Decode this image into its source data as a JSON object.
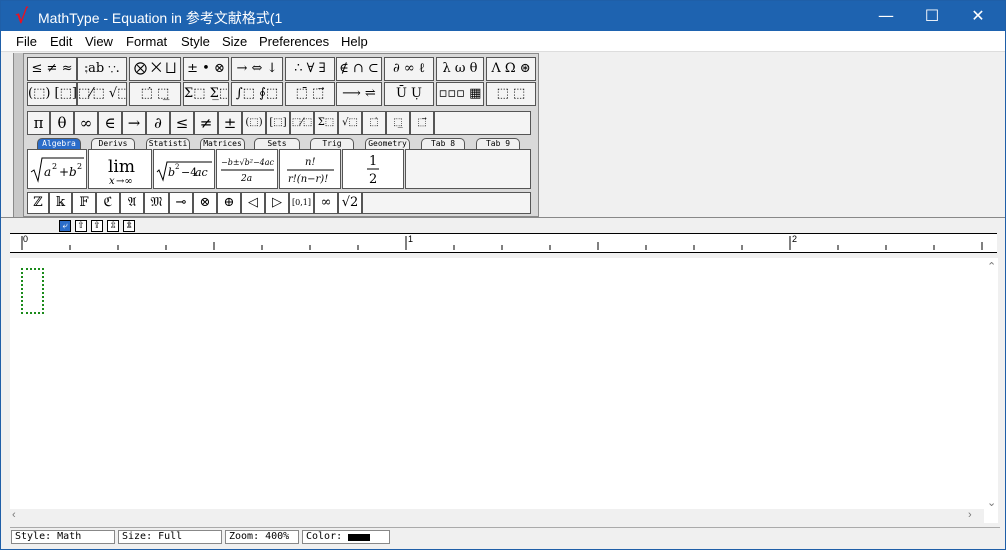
{
  "window": {
    "title": "MathType - Equation in 参考文献格式(1",
    "icon": "mathtype-logo-icon",
    "logo_text": "√",
    "controls": {
      "minimize": "—",
      "maximize": "☐",
      "close": "✕"
    }
  },
  "menubar": {
    "items": [
      "File",
      "Edit",
      "View",
      "Format",
      "Style",
      "Size",
      "Preferences",
      "Help"
    ]
  },
  "palette": {
    "row1": [
      "≤ ≠ ≈",
      "⨟ab ∵.",
      "⨂ ⨉ ⨆",
      "± • ⊗",
      "→ ⇔ ↓",
      "∴ ∀ ∃",
      "∉ ∩ ⊂",
      "∂ ∞ ℓ",
      "λ ω θ",
      "Λ Ω ⊛"
    ],
    "row2": [
      "(⬚) [⬚]",
      "⬚⁄⬚ √⬚",
      "⬚̇ ⬚̲",
      "Σ⬚ Σ̲⬚",
      "∫⬚ ∮⬚",
      "⬚̄ ⬚⃗",
      "⟶ ⇌",
      "Ū Ụ",
      "▫▫▫ ▦",
      "⬚ ⬚"
    ],
    "row3": [
      "π",
      "θ",
      "∞",
      "∈",
      "→",
      "∂",
      "≤",
      "≠",
      "±",
      "(⬚)",
      "[⬚]",
      "⬚⁄⬚",
      "Σ⬚",
      "√⬚",
      "⬚̇",
      "⬚̲",
      "⬚⃗"
    ],
    "tabs": [
      "Algebra",
      "Derivs",
      "Statisti",
      "Matrices",
      "Sets",
      "Trig",
      "Geometry",
      "Tab 8",
      "Tab 9"
    ],
    "active_tab": "Algebra",
    "templates": [
      "√(a² + b²)",
      "lim x→∞",
      "√(b² − 4ac)",
      "(−b±√(b²−4ac))/2a",
      "n!/(r!(n−r)!)",
      "1/2"
    ],
    "library_row": [
      "ℤ",
      "𝕜",
      "𝔽",
      "ℭ",
      "𝔄",
      "𝔐",
      "⊸",
      "⊗",
      "⊕",
      "◁",
      "▷",
      "[0,1]",
      "∞",
      "√2"
    ]
  },
  "alignment": {
    "buttons": [
      "⤶",
      "⇧",
      "⇪",
      "⇫",
      "⇭"
    ],
    "active_index": 0
  },
  "ruler": {
    "labels": [
      "0",
      "1",
      "2"
    ]
  },
  "status": {
    "style": "Style: Math",
    "size": "Size: Full",
    "zoom": "Zoom: 400%",
    "color_label": "Color:",
    "color": "#000000"
  },
  "colors": {
    "titlebar": "#1e63b0",
    "active_tab": "#2a6cc9",
    "slot_border": "#1a8a1a"
  }
}
